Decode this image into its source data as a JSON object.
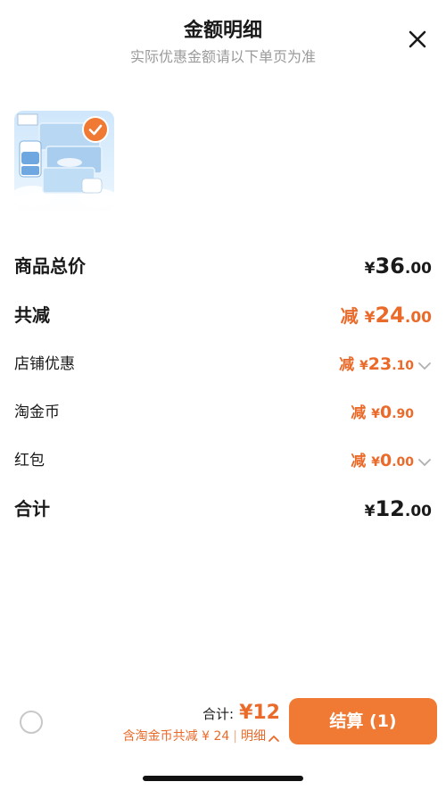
{
  "header": {
    "title": "金额明细",
    "subtitle": "实际优惠金额请以下单页为准"
  },
  "product": {
    "image_icon": "diaper-package-image",
    "checked": true
  },
  "rows": [
    {
      "label": "商品总价",
      "prefix": "",
      "currency": "¥",
      "integer": "36",
      "decimal": ".00"
    },
    {
      "label": "共减",
      "prefix": "减 ",
      "currency": "¥",
      "integer": "24",
      "decimal": ".00"
    },
    {
      "label": "店铺优惠",
      "prefix": "减 ",
      "currency": "¥",
      "integer": "23",
      "decimal": ".10"
    },
    {
      "label": "淘金币",
      "prefix": "减 ",
      "currency": "¥",
      "integer": "0",
      "decimal": ".90"
    },
    {
      "label": "红包",
      "prefix": "减 ",
      "currency": "¥",
      "integer": "0",
      "decimal": ".00"
    },
    {
      "label": "合计",
      "prefix": "",
      "currency": "¥",
      "integer": "12",
      "decimal": ".00"
    }
  ],
  "footer": {
    "total_label": "合计:",
    "total_value": "¥12",
    "coin_note": "含淘金币共减 ¥ 24",
    "detail_link": "明细",
    "checkout_label": "结算 (1)"
  },
  "colors": {
    "accent": "#f07a33",
    "discount_text": "#ea6a2a"
  }
}
